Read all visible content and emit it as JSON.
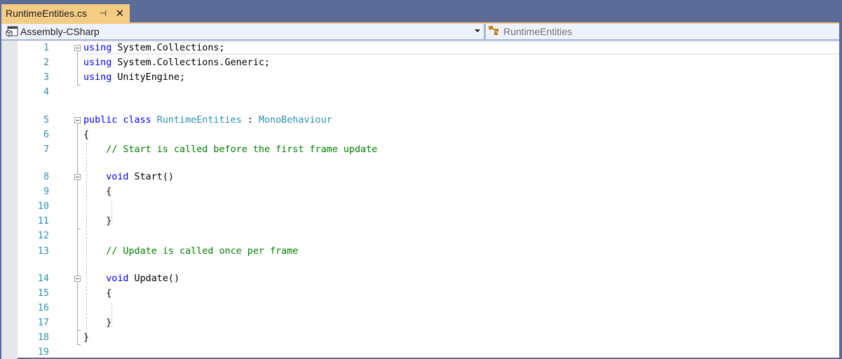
{
  "tab": {
    "title": "RuntimeEntities.cs",
    "pin_icon": "pin-icon",
    "close_icon": "close-icon"
  },
  "navbar": {
    "project": "Assembly-CSharp",
    "project_icon": "csharp-project-icon",
    "type": "RuntimeEntities",
    "type_icon": "class-icon"
  },
  "colors": {
    "tab_active": "#f5cc84",
    "frame": "#5d6b99",
    "keyword": "#0000ff",
    "type": "#2b91af",
    "comment": "#008000",
    "line_number": "#2b91af"
  },
  "lines": [
    {
      "n": "1",
      "parts": [
        [
          "kw",
          "using"
        ],
        [
          "",
          "System.Collections;"
        ]
      ]
    },
    {
      "n": "2",
      "parts": [
        [
          "kw",
          "using"
        ],
        [
          "",
          "System.Collections.Generic;"
        ]
      ]
    },
    {
      "n": "3",
      "parts": [
        [
          "kw",
          "using"
        ],
        [
          "",
          "UnityEngine;"
        ]
      ]
    },
    {
      "n": "4",
      "parts": []
    },
    {
      "n": "5",
      "parts": [
        [
          "kw",
          "public"
        ],
        [
          "kw",
          "class"
        ],
        [
          "type",
          "RuntimeEntities"
        ],
        [
          "",
          ":"
        ],
        [
          "type",
          "MonoBehaviour"
        ]
      ]
    },
    {
      "n": "6",
      "parts": [
        [
          "",
          "{"
        ]
      ]
    },
    {
      "n": "7",
      "parts": [
        [
          "cmt",
          "    // Start is called before the first frame update"
        ]
      ]
    },
    {
      "n": "8",
      "parts": [
        [
          "",
          "    "
        ],
        [
          "kw",
          "void"
        ],
        [
          "",
          "Start()"
        ]
      ]
    },
    {
      "n": "9",
      "parts": [
        [
          "",
          "    {"
        ]
      ]
    },
    {
      "n": "10",
      "parts": []
    },
    {
      "n": "11",
      "parts": [
        [
          "",
          "    }"
        ]
      ]
    },
    {
      "n": "12",
      "parts": []
    },
    {
      "n": "13",
      "parts": [
        [
          "cmt",
          "    // Update is called once per frame"
        ]
      ]
    },
    {
      "n": "14",
      "parts": [
        [
          "",
          "    "
        ],
        [
          "kw",
          "void"
        ],
        [
          "",
          "Update()"
        ]
      ]
    },
    {
      "n": "15",
      "parts": [
        [
          "",
          "    {"
        ]
      ]
    },
    {
      "n": "16",
      "parts": []
    },
    {
      "n": "17",
      "parts": [
        [
          "",
          "    }"
        ]
      ]
    },
    {
      "n": "18",
      "parts": [
        [
          "",
          "}"
        ]
      ]
    },
    {
      "n": "19",
      "parts": []
    }
  ]
}
